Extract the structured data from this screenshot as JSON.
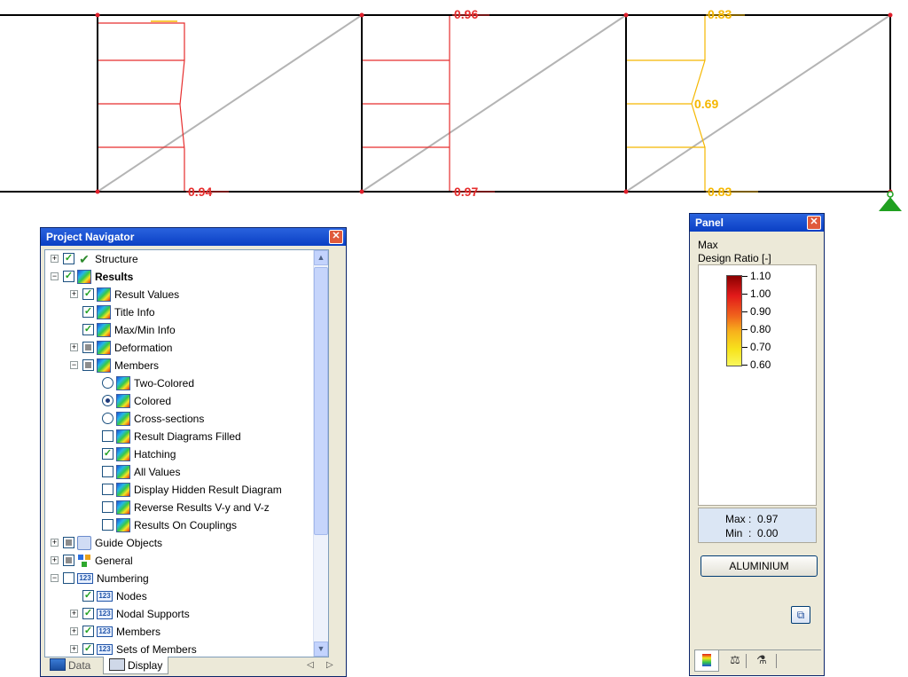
{
  "diagram": {
    "colors": {
      "chord": "#000000",
      "diagonal": "#b4b4b4",
      "node": "#e0202c",
      "high": "#e62d2d",
      "mid": "#f5b700",
      "support": "#20a020"
    },
    "values": {
      "bay1_bottom": "0.94",
      "bay2_top": "0.96",
      "bay2_bottom": "0.97",
      "bay3_top": "0.83",
      "bay3_mid": "0.69",
      "bay3_bottom": "0.83"
    }
  },
  "navigator": {
    "title": "Project Navigator",
    "items": [
      {
        "label": "Structure",
        "state": "checked",
        "icon": "structure-icon"
      },
      {
        "label": "Results",
        "state": "checked",
        "icon": "results-icon"
      },
      {
        "label": "Result Values",
        "state": "checked",
        "icon": "results-icon"
      },
      {
        "label": "Title Info",
        "state": "checked",
        "icon": "results-icon"
      },
      {
        "label": "Max/Min Info",
        "state": "checked",
        "icon": "results-icon"
      },
      {
        "label": "Deformation",
        "state": "partial",
        "icon": "results-icon"
      },
      {
        "label": "Members",
        "state": "partial",
        "icon": "results-icon"
      },
      {
        "label": "Two-Colored",
        "state": "radio-off",
        "icon": "results-icon"
      },
      {
        "label": "Colored",
        "state": "radio-on",
        "icon": "results-icon"
      },
      {
        "label": "Cross-sections",
        "state": "radio-off",
        "icon": "results-icon"
      },
      {
        "label": "Result Diagrams Filled",
        "state": "unchecked",
        "icon": "results-icon"
      },
      {
        "label": "Hatching",
        "state": "checked",
        "icon": "results-icon"
      },
      {
        "label": "All Values",
        "state": "unchecked",
        "icon": "results-icon"
      },
      {
        "label": "Display Hidden Result Diagram",
        "state": "unchecked",
        "icon": "results-icon"
      },
      {
        "label": "Reverse Results V-y and V-z",
        "state": "unchecked",
        "icon": "results-icon"
      },
      {
        "label": "Results On Couplings",
        "state": "unchecked",
        "icon": "results-icon"
      },
      {
        "label": "Guide Objects",
        "state": "partial",
        "icon": "guide-objects-icon"
      },
      {
        "label": "General",
        "state": "partial",
        "icon": "general-icon"
      },
      {
        "label": "Numbering",
        "state": "unchecked",
        "icon": "numbering-icon"
      },
      {
        "label": "Nodes",
        "state": "checked",
        "icon": "numbering-icon"
      },
      {
        "label": "Nodal Supports",
        "state": "checked",
        "icon": "numbering-icon"
      },
      {
        "label": "Members",
        "state": "checked",
        "icon": "numbering-icon"
      },
      {
        "label": "Sets of Members",
        "state": "checked",
        "icon": "numbering-icon"
      }
    ],
    "tabs": {
      "data": "Data",
      "display": "Display"
    },
    "num_icon_text": "123"
  },
  "panel": {
    "title": "Panel",
    "heading_line1": "Max",
    "heading_line2": "Design Ratio [-]",
    "legend_values": [
      "1.10",
      "1.00",
      "0.90",
      "0.80",
      "0.70",
      "0.60"
    ],
    "max_line": "Max :  0.97",
    "min_line": "Min  :  0.00",
    "material_button": "ALUMINIUM"
  }
}
